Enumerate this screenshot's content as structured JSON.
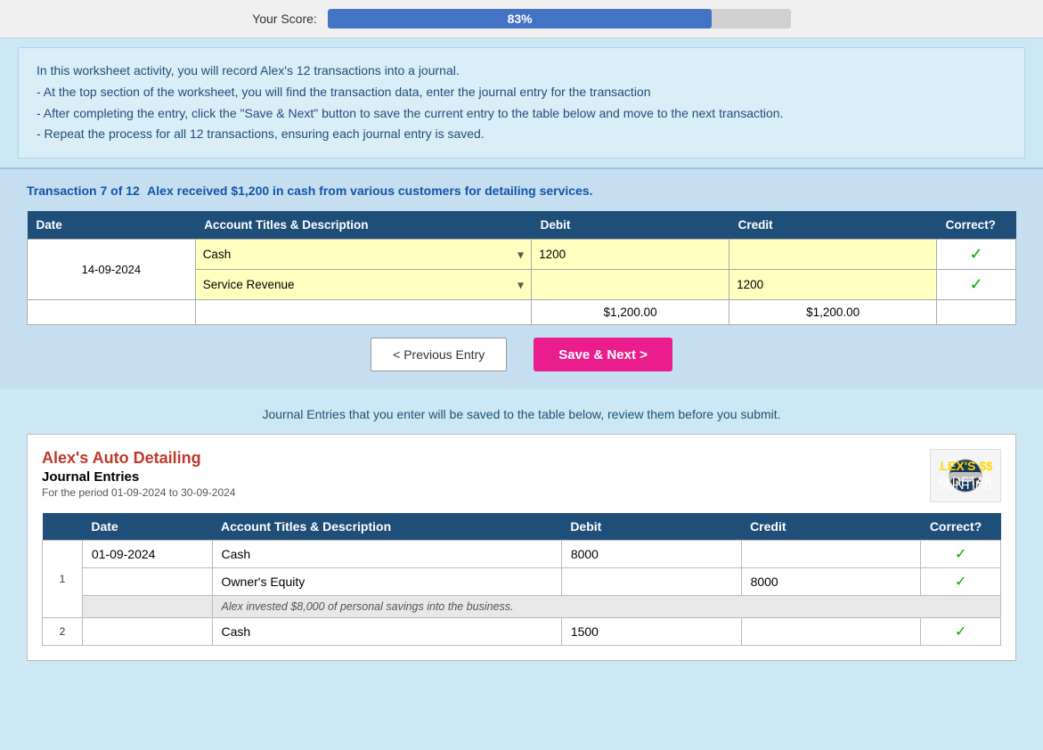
{
  "score": {
    "label": "Your Score:",
    "percent": 83,
    "display": "83%",
    "bar_width": "83%"
  },
  "instructions": {
    "line1": "In this worksheet activity, you will record Alex's 12 transactions into a journal.",
    "line2": "- At the top section of the worksheet, you will find the transaction data, enter the journal entry for the transaction",
    "line3": "- After completing the entry, click the \"Save & Next\" button to save the current entry to the table below and move to the next transaction.",
    "line4": "- Repeat the process for all 12 transactions, ensuring each journal entry is saved."
  },
  "transaction": {
    "label": "Transaction 7 of 12",
    "description": "Alex received $1,200 in cash from various customers for detailing services.",
    "date": "14-09-2024",
    "rows": [
      {
        "account": "Cash",
        "debit": "1200",
        "credit": "",
        "correct": true
      },
      {
        "account": "Service Revenue",
        "debit": "",
        "credit": "1200",
        "correct": true
      }
    ],
    "total_debit": "$1,200.00",
    "total_credit": "$1,200.00",
    "columns": {
      "date": "Date",
      "account": "Account Titles & Description",
      "debit": "Debit",
      "credit": "Credit",
      "correct": "Correct?"
    }
  },
  "buttons": {
    "previous": "< Previous Entry",
    "save_next": "Save & Next >"
  },
  "journal": {
    "subtitle": "Journal Entries that you enter will be saved to the table below, review them before you submit.",
    "company": "Alex's Auto Detailing",
    "title": "Journal Entries",
    "period": "For the period 01-09-2024 to 30-09-2024",
    "columns": {
      "date": "Date",
      "account": "Account Titles & Description",
      "debit": "Debit",
      "credit": "Credit",
      "correct": "Correct?"
    },
    "entries": [
      {
        "row_num": "1",
        "date": "01-09-2024",
        "lines": [
          {
            "account": "Cash",
            "debit": "8000",
            "credit": "",
            "correct": true
          },
          {
            "account": "Owner's Equity",
            "debit": "",
            "credit": "8000",
            "correct": true
          },
          {
            "account": "Alex invested $8,000 of personal savings into the business.",
            "debit": "",
            "credit": "",
            "correct": false,
            "is_desc": true
          }
        ]
      },
      {
        "row_num": "2",
        "date": "",
        "lines": [
          {
            "account": "Cash",
            "debit": "1500",
            "credit": "",
            "correct": true
          }
        ]
      }
    ]
  }
}
